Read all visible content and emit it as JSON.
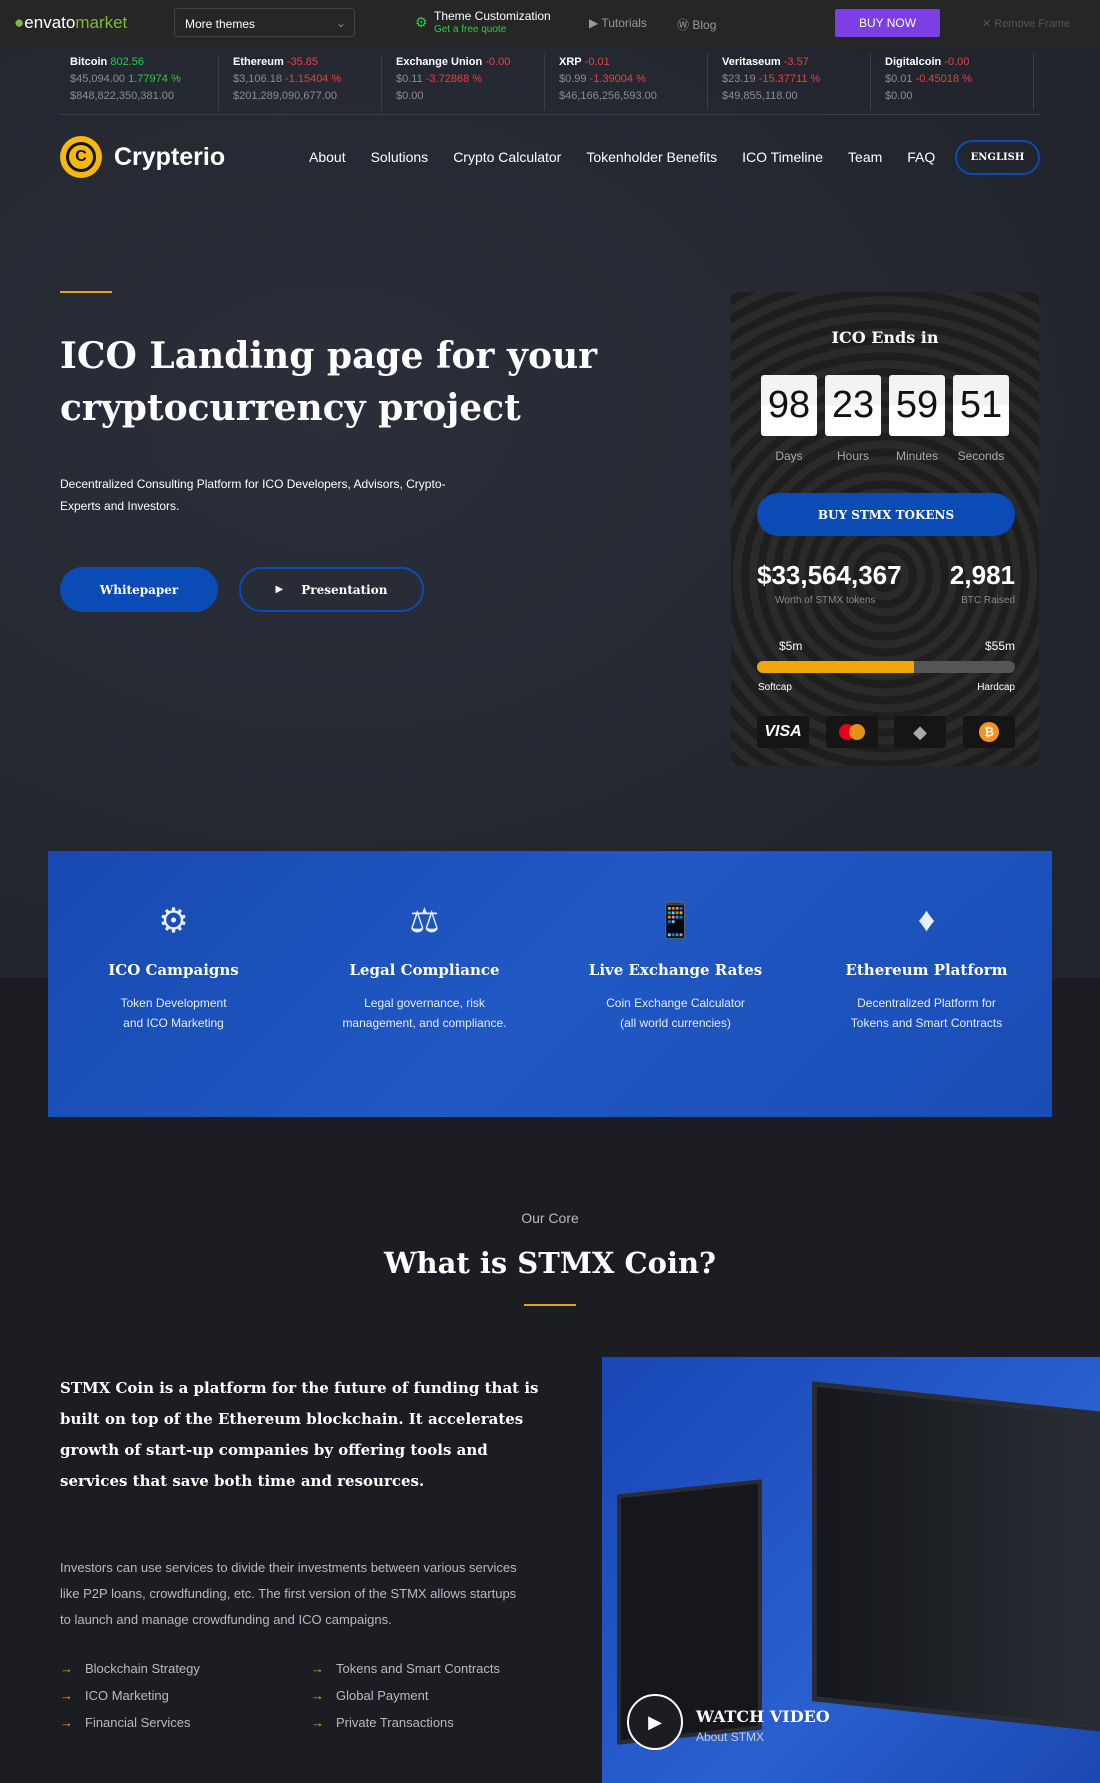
{
  "topbar": {
    "logo": "envato",
    "logo2": "market",
    "themes": "More themes",
    "custom_title": "Theme Customization",
    "custom_sub": "Get a free quote",
    "tutorials": "Tutorials",
    "blog": "Blog",
    "buy": "BUY NOW",
    "remove": "Remove Frame"
  },
  "ticker": [
    {
      "name": "Bitcoin",
      "change": "802.56",
      "price": "$45,094.00",
      "pct": "1.77974 %",
      "cap": "$848,822,350,381.00",
      "up": true
    },
    {
      "name": "Ethereum",
      "change": "-35.85",
      "price": "$3,106.18",
      "pct": "-1.15404 %",
      "cap": "$201,289,090,677.00",
      "up": false
    },
    {
      "name": "Exchange Union",
      "change": "-0.00",
      "price": "$0.11",
      "pct": "-3.72868 %",
      "cap": "$0.00",
      "up": false
    },
    {
      "name": "XRP",
      "change": "-0.01",
      "price": "$0.99",
      "pct": "-1.39004 %",
      "cap": "$46,166,256,593.00",
      "up": false
    },
    {
      "name": "Veritaseum",
      "change": "-3.57",
      "price": "$23.19",
      "pct": "-15.37711 %",
      "cap": "$49,855,118.00",
      "up": false
    },
    {
      "name": "Digitalcoin",
      "change": "-0.00",
      "price": "$0.01",
      "pct": "-0.45018 %",
      "cap": "$0.00",
      "up": false
    }
  ],
  "nav": {
    "brand": "Crypterio",
    "items": [
      "About",
      "Solutions",
      "Crypto Calculator",
      "Tokenholder Benefits",
      "ICO Timeline",
      "Team",
      "FAQ"
    ],
    "lang": "ENGLISH"
  },
  "hero": {
    "title1": "ICO Landing page for your",
    "title2": "cryptocurrency project",
    "desc1": "Decentralized Consulting Platform for ICO Developers, Advisors, Crypto-",
    "desc2": "Experts and Investors.",
    "whitepaper": "Whitepaper",
    "presentation": "Presentation"
  },
  "card": {
    "title": "ICO Ends in",
    "days": "98",
    "hours": "23",
    "minutes": "59",
    "seconds": "51",
    "l_days": "Days",
    "l_hours": "Hours",
    "l_minutes": "Minutes",
    "l_seconds": "Seconds",
    "buy": "BUY STMX TOKENS",
    "worth": "$33,564,367",
    "worth_label": "Worth of STMX tokens",
    "btc": "2,981",
    "btc_label": "BTC Raised",
    "soft": "$5m",
    "hard": "$55m",
    "soft_label": "Softcap",
    "hard_label": "Hardcap",
    "progress_pct": 61,
    "visa": "VISA"
  },
  "features": [
    {
      "title": "ICO Campaigns",
      "l1": "Token Development",
      "l2": "and ICO Marketing"
    },
    {
      "title": "Legal Compliance",
      "l1": "Legal governance, risk",
      "l2": "management, and compliance."
    },
    {
      "title": "Live Exchange Rates",
      "l1": "Coin Exchange Calculator",
      "l2": "(all world currencies)"
    },
    {
      "title": "Ethereum Platform",
      "l1": "Decentralized Platform for",
      "l2": "Tokens and Smart Contracts"
    }
  ],
  "core": {
    "kicker": "Our Core",
    "title": "What is STMX Coin?",
    "lead": "STMX Coin is a platform for the future of funding that is built on top of the Ethereum blockchain. It accelerates growth of start-up companies by offering tools and services that save both time and resources.",
    "body": "Investors can use services to divide their investments between various services like P2P loans, crowdfunding, etc. The first version of the STMX allows startups to launch and manage crowdfunding and ICO campaigns.",
    "list_left": [
      "Blockchain Strategy",
      "ICO Marketing",
      "Financial Services"
    ],
    "list_right": [
      "Tokens and Smart Contracts",
      "Global Payment",
      "Private Transactions"
    ],
    "video_title": "WATCH VIDEO",
    "video_sub": "About STMX"
  },
  "colors": {
    "accent": "#e8a317",
    "blue": "#0b4bb5",
    "band": "#1d52bd",
    "purple": "#7b3fe4"
  }
}
